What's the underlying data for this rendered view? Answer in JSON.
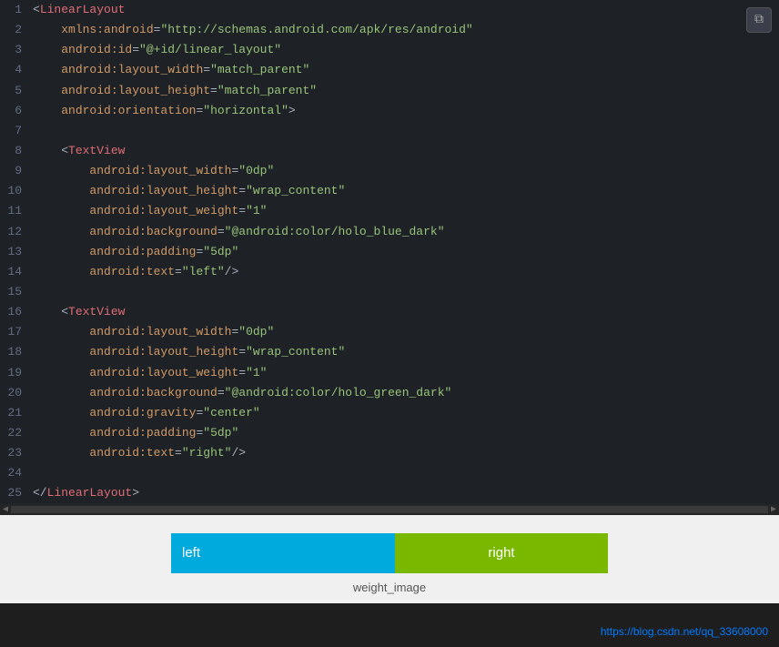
{
  "code": {
    "lines": [
      {
        "num": 1,
        "html": "<span class='punct'>&lt;</span><span class='tag'>LinearLayout</span>"
      },
      {
        "num": 2,
        "html": "    <span class='attr-name'>xmlns:android</span><span class='equal'>=</span><span class='attr-value'>\"http://schemas.android.com/apk/res/android\"</span>"
      },
      {
        "num": 3,
        "html": "    <span class='attr-name'>android:id</span><span class='equal'>=</span><span class='attr-value'>\"@+id/linear_layout\"</span>"
      },
      {
        "num": 4,
        "html": "    <span class='attr-name'>android:layout_width</span><span class='equal'>=</span><span class='attr-value'>\"match_parent\"</span>"
      },
      {
        "num": 5,
        "html": "    <span class='attr-name'>android:layout_height</span><span class='equal'>=</span><span class='attr-value'>\"match_parent\"</span>"
      },
      {
        "num": 6,
        "html": "    <span class='attr-name'>android:orientation</span><span class='equal'>=</span><span class='attr-value'>\"horizontal\"</span><span class='punct'>&gt;</span>"
      },
      {
        "num": 7,
        "html": ""
      },
      {
        "num": 8,
        "html": "    <span class='punct'>&lt;</span><span class='tag'>TextView</span>"
      },
      {
        "num": 9,
        "html": "        <span class='attr-name'>android:layout_width</span><span class='equal'>=</span><span class='attr-value'>\"0dp\"</span>"
      },
      {
        "num": 10,
        "html": "        <span class='attr-name'>android:layout_height</span><span class='equal'>=</span><span class='attr-value'>\"wrap_content\"</span>"
      },
      {
        "num": 11,
        "html": "        <span class='attr-name'>android:layout_weight</span><span class='equal'>=</span><span class='attr-value'>\"1\"</span>"
      },
      {
        "num": 12,
        "html": "        <span class='attr-name'>android:background</span><span class='equal'>=</span><span class='attr-value'>\"@android:color/holo_blue_dark\"</span>"
      },
      {
        "num": 13,
        "html": "        <span class='attr-name'>android:padding</span><span class='equal'>=</span><span class='attr-value'>\"5dp\"</span>"
      },
      {
        "num": 14,
        "html": "        <span class='attr-name'>android:text</span><span class='equal'>=</span><span class='attr-value'>\"left\"</span><span class='punct'>/&gt;</span>"
      },
      {
        "num": 15,
        "html": ""
      },
      {
        "num": 16,
        "html": "    <span class='punct'>&lt;</span><span class='tag'>TextView</span>"
      },
      {
        "num": 17,
        "html": "        <span class='attr-name'>android:layout_width</span><span class='equal'>=</span><span class='attr-value'>\"0dp\"</span>"
      },
      {
        "num": 18,
        "html": "        <span class='attr-name'>android:layout_height</span><span class='equal'>=</span><span class='attr-value'>\"wrap_content\"</span>"
      },
      {
        "num": 19,
        "html": "        <span class='attr-name'>android:layout_weight</span><span class='equal'>=</span><span class='attr-value'>\"1\"</span>"
      },
      {
        "num": 20,
        "html": "        <span class='attr-name'>android:background</span><span class='equal'>=</span><span class='attr-value'>\"@android:color/holo_green_dark\"</span>"
      },
      {
        "num": 21,
        "html": "        <span class='attr-name'>android:gravity</span><span class='equal'>=</span><span class='attr-value'>\"center\"</span>"
      },
      {
        "num": 22,
        "html": "        <span class='attr-name'>android:padding</span><span class='equal'>=</span><span class='attr-value'>\"5dp\"</span>"
      },
      {
        "num": 23,
        "html": "        <span class='attr-name'>android:text</span><span class='equal'>=</span><span class='attr-value'>\"right\"</span><span class='punct'>/&gt;</span>"
      },
      {
        "num": 24,
        "html": ""
      },
      {
        "num": 25,
        "html": "<span class='punct'>&lt;/</span><span class='tag'>LinearLayout</span><span class='punct'>&gt;</span>"
      }
    ]
  },
  "copy_button": "⧉",
  "preview": {
    "left_text": "left",
    "right_text": "right",
    "label": "weight_image",
    "link_text": "https://blog.csdn.net/qq_33608000",
    "link_url": "#"
  }
}
